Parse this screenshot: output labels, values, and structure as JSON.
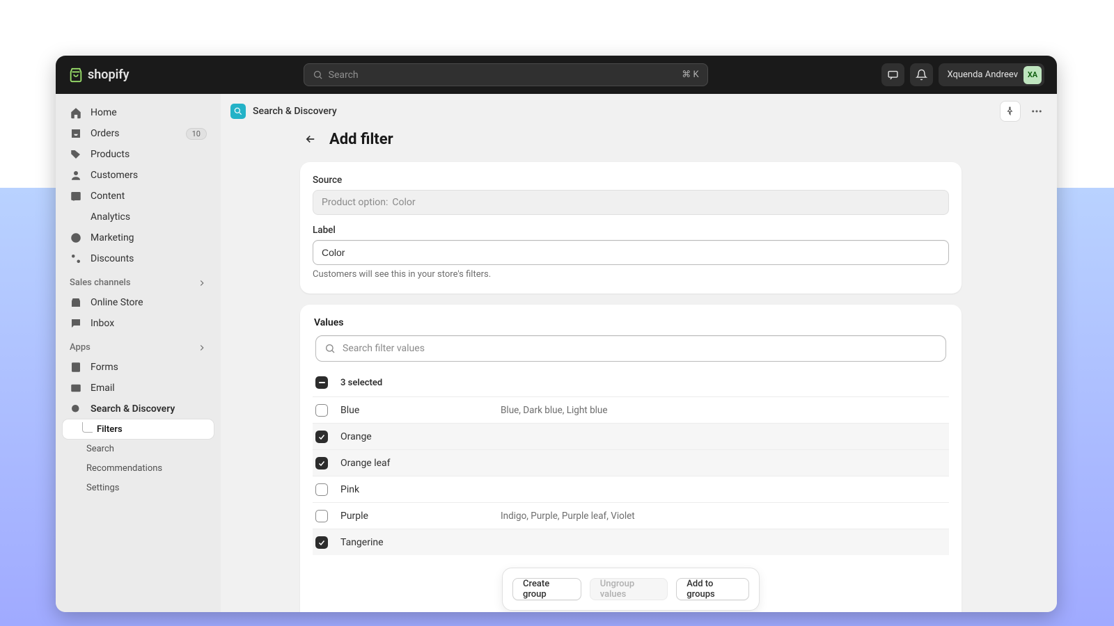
{
  "brand": "shopify",
  "search": {
    "placeholder": "Search",
    "kbd": "⌘ K"
  },
  "topbar": {
    "user_name": "Xquenda Andreev",
    "user_initials": "XA"
  },
  "sidebar": {
    "home": "Home",
    "orders": "Orders",
    "orders_badge": "10",
    "products": "Products",
    "customers": "Customers",
    "content": "Content",
    "analytics": "Analytics",
    "marketing": "Marketing",
    "discounts": "Discounts",
    "sales_channels": "Sales channels",
    "online_store": "Online Store",
    "inbox": "Inbox",
    "apps": "Apps",
    "forms": "Forms",
    "email": "Email",
    "search_discovery": "Search & Discovery",
    "filters": "Filters",
    "search_sub": "Search",
    "recommendations": "Recommendations",
    "settings": "Settings"
  },
  "crumb": {
    "app": "Search & Discovery"
  },
  "page": {
    "title": "Add filter"
  },
  "source": {
    "label": "Source",
    "field_prefix": "Product option:",
    "field_value": "Color"
  },
  "label_field": {
    "label": "Label",
    "value": "Color",
    "hint": "Customers will see this in your store's filters."
  },
  "values_section": {
    "title": "Values",
    "search_placeholder": "Search filter values",
    "selected_text": "3 selected",
    "rows": [
      {
        "name": "Blue",
        "selected": false,
        "extras": "Blue, Dark blue, Light blue"
      },
      {
        "name": "Orange",
        "selected": true,
        "extras": ""
      },
      {
        "name": "Orange leaf",
        "selected": true,
        "extras": ""
      },
      {
        "name": "Pink",
        "selected": false,
        "extras": ""
      },
      {
        "name": "Purple",
        "selected": false,
        "extras": "Indigo, Purple, Purple leaf, Violet"
      },
      {
        "name": "Tangerine",
        "selected": true,
        "extras": ""
      }
    ]
  },
  "actions": {
    "create_group": "Create group",
    "ungroup": "Ungroup values",
    "add_to_groups": "Add to groups"
  }
}
